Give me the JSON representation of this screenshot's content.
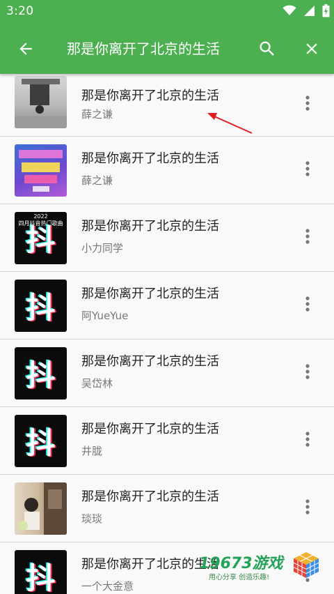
{
  "status_bar": {
    "time": "3:20",
    "icons": [
      "wifi-icon",
      "signal-icon",
      "battery-icon"
    ]
  },
  "toolbar": {
    "title": "那是你离开了北京的生活",
    "back_icon": "arrow-back-icon",
    "search_icon": "search-icon",
    "close_icon": "close-icon",
    "color": "#4caf50"
  },
  "songs": [
    {
      "title": "那是你离开了北京的生活",
      "artist": "薛之谦",
      "thumb": "photo"
    },
    {
      "title": "那是你离开了北京的生活",
      "artist": "薛之谦",
      "thumb": "idol-cover"
    },
    {
      "title": "那是你离开了北京的生活",
      "artist": "小力同学",
      "thumb": "douyin",
      "caption": "2022\n四月抖音热门歌曲"
    },
    {
      "title": "那是你离开了北京的生活",
      "artist": "阿YueYue",
      "thumb": "douyin"
    },
    {
      "title": "那是你离开了北京的生活",
      "artist": "吴岱林",
      "thumb": "douyin"
    },
    {
      "title": "那是你离开了北京的生活",
      "artist": "井胧",
      "thumb": "douyin"
    },
    {
      "title": "那是你离开了北京的生活",
      "artist": "琰琰",
      "thumb": "photo"
    },
    {
      "title": "那是你离开了北京的生活",
      "artist": "一个大金意",
      "thumb": "douyin"
    }
  ],
  "douyin_glyph": "抖",
  "watermark": {
    "main": "19673游戏",
    "sub": "用心分享  创造乐趣!"
  }
}
